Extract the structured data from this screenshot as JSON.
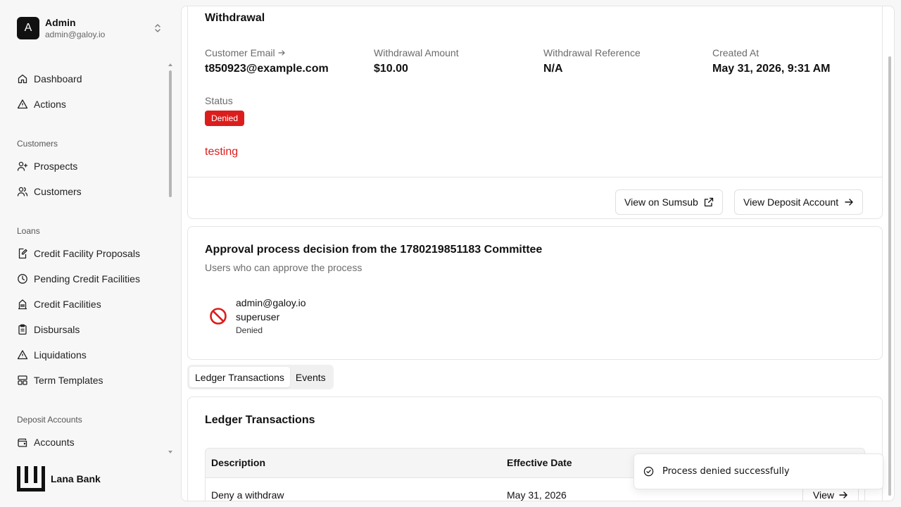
{
  "user": {
    "initial": "A",
    "name": "Admin",
    "email": "admin@galoy.io"
  },
  "nav": {
    "top": [
      {
        "label": "Dashboard",
        "icon": "home-icon"
      },
      {
        "label": "Actions",
        "icon": "triangle-alert-icon"
      }
    ],
    "groups": [
      {
        "title": "Customers",
        "items": [
          {
            "label": "Prospects",
            "icon": "user-plus-icon"
          },
          {
            "label": "Customers",
            "icon": "users-icon"
          }
        ]
      },
      {
        "title": "Loans",
        "items": [
          {
            "label": "Credit Facility Proposals",
            "icon": "file-pen-icon"
          },
          {
            "label": "Pending Credit Facilities",
            "icon": "clock-icon"
          },
          {
            "label": "Credit Facilities",
            "icon": "building-icon"
          },
          {
            "label": "Disbursals",
            "icon": "clipboard-icon"
          },
          {
            "label": "Liquidations",
            "icon": "triangle-alert-icon"
          },
          {
            "label": "Term Templates",
            "icon": "layout-icon"
          }
        ]
      },
      {
        "title": "Deposit Accounts",
        "items": [
          {
            "label": "Accounts",
            "icon": "wallet-icon"
          }
        ]
      }
    ]
  },
  "brand": {
    "name": "Lana Bank"
  },
  "withdrawal": {
    "title": "Withdrawal",
    "fields": {
      "customer_email_label": "Customer Email",
      "customer_email": "t850923@example.com",
      "amount_label": "Withdrawal Amount",
      "amount": "$10.00",
      "reference_label": "Withdrawal Reference",
      "reference": "N/A",
      "created_label": "Created At",
      "created": "May 31, 2026, 9:31 AM",
      "status_label": "Status",
      "status": "Denied"
    },
    "denial_reason": "testing",
    "buttons": {
      "sumsub": "View on Sumsub",
      "deposit_account": "View Deposit Account"
    }
  },
  "approval": {
    "title": "Approval process decision from the 1780219851183 Committee",
    "subtitle": "Users who can approve the process",
    "approver": {
      "email": "admin@galoy.io",
      "role": "superuser",
      "status": "Denied"
    }
  },
  "tabs": [
    {
      "label": "Ledger Transactions",
      "active": true
    },
    {
      "label": "Events",
      "active": false
    }
  ],
  "ledger": {
    "title": "Ledger Transactions",
    "columns": [
      "Description",
      "Effective Date"
    ],
    "rows": [
      {
        "description": "Deny a withdraw",
        "date": "May 31, 2026",
        "action": "View"
      }
    ]
  },
  "toast": {
    "message": "Process denied successfully"
  },
  "colors": {
    "denied": "#dc1d1d",
    "sidebar_bg": "#f7f7f7"
  }
}
